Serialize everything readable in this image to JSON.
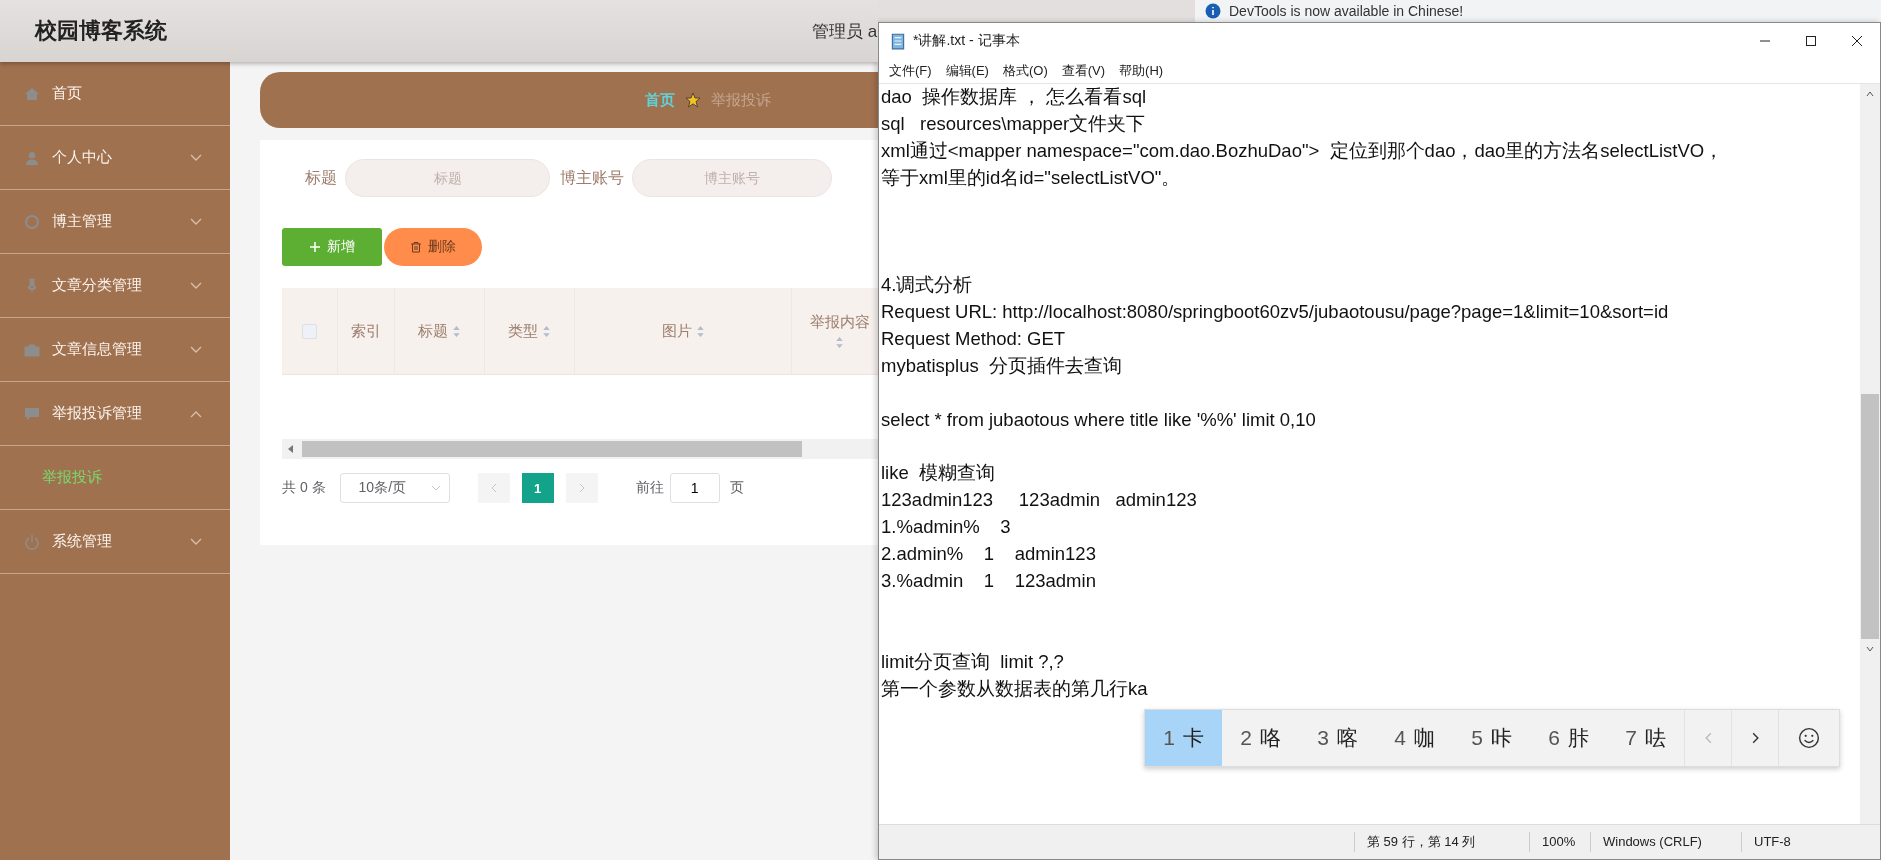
{
  "header": {
    "title": "校园博客系统",
    "user": "管理员 a"
  },
  "sidebar": {
    "items": [
      {
        "label": "首页",
        "kind": "link"
      },
      {
        "label": "个人中心",
        "kind": "menu",
        "expanded": false
      },
      {
        "label": "博主管理",
        "kind": "menu",
        "expanded": false
      },
      {
        "label": "文章分类管理",
        "kind": "menu",
        "expanded": false
      },
      {
        "label": "文章信息管理",
        "kind": "menu",
        "expanded": false
      },
      {
        "label": "举报投诉管理",
        "kind": "menu",
        "expanded": true,
        "children": [
          {
            "label": "举报投诉",
            "selected": true
          }
        ]
      },
      {
        "label": "系统管理",
        "kind": "menu",
        "expanded": false
      }
    ]
  },
  "breadcrumb": [
    "首页",
    "举报投诉"
  ],
  "search": [
    {
      "label": "标题",
      "placeholder": "标题"
    },
    {
      "label": "博主账号",
      "placeholder": "博主账号"
    }
  ],
  "buttons": [
    {
      "label": "新增",
      "kind": "add"
    },
    {
      "label": "删除",
      "kind": "delete"
    }
  ],
  "table": {
    "select_all": {
      "checked": false
    },
    "columns": [
      {
        "label": "索引",
        "sortable": false
      },
      {
        "label": "标题",
        "sortable": true
      },
      {
        "label": "类型",
        "sortable": true
      },
      {
        "label": "图片",
        "sortable": true
      },
      {
        "label": "举报内容",
        "sortable": true
      }
    ]
  },
  "pagination": {
    "total": "共 0 条",
    "page_size": "10条/页",
    "pages": [
      {
        "label": "1",
        "selected": true
      }
    ],
    "goto_label": "前往",
    "goto_value": "1",
    "goto_suffix": "页"
  },
  "devtools_notice": "DevTools is now available in Chinese!",
  "notepad": {
    "title": "*讲解.txt - 记事本",
    "menu": [
      "文件(F)",
      "编辑(E)",
      "格式(O)",
      "查看(V)",
      "帮助(H)"
    ],
    "lines": [
      {
        "kind": "text",
        "text": "dao  操作数据库 ， 怎么看看sql"
      },
      {
        "kind": "text",
        "text": "sql   resources\\mapper文件夹下"
      },
      {
        "kind": "text",
        "text": "xml通过<mapper namespace=\"com.dao.BozhuDao\">  定位到那个dao，dao里的方法名selectListVO，"
      },
      {
        "kind": "text",
        "text": "等于xml里的id名id=\"selectListVO\"。"
      },
      {
        "kind": "blank"
      },
      {
        "kind": "blank"
      },
      {
        "kind": "blank"
      },
      {
        "kind": "text",
        "text": "4.调式分析"
      },
      {
        "kind": "text",
        "text": "Request URL: http://localhost:8080/springboot60zv5/jubaotousu/page?page=1&limit=10&sort=id"
      },
      {
        "kind": "text",
        "text": "Request Method: GET"
      },
      {
        "kind": "text",
        "text": "mybatisplus  分页插件去查询"
      },
      {
        "kind": "blank"
      },
      {
        "kind": "text",
        "text": "select * from jubaotous where title like '%%' limit 0,10"
      },
      {
        "kind": "blank"
      },
      {
        "kind": "text",
        "text": "like  模糊查询"
      },
      {
        "kind": "text",
        "text": "123admin123     123admin   admin123"
      },
      {
        "kind": "text",
        "text": "1.%admin%    3"
      },
      {
        "kind": "text",
        "text": "2.admin%    1    admin123"
      },
      {
        "kind": "text",
        "text": "3.%admin    1    123admin"
      },
      {
        "kind": "blank"
      },
      {
        "kind": "blank"
      },
      {
        "kind": "text",
        "text": "limit分页查询  limit ?,?"
      },
      {
        "kind": "text",
        "text": "第一个参数从数据表的第几行ka"
      }
    ],
    "ime": {
      "candidates": [
        {
          "index": "1",
          "char": "卡",
          "selected": true
        },
        {
          "index": "2",
          "char": "咯",
          "selected": false
        },
        {
          "index": "3",
          "char": "喀",
          "selected": false
        },
        {
          "index": "4",
          "char": "咖",
          "selected": false
        },
        {
          "index": "5",
          "char": "咔",
          "selected": false
        },
        {
          "index": "6",
          "char": "胩",
          "selected": false
        },
        {
          "index": "7",
          "char": "呿",
          "selected": false
        }
      ]
    },
    "status_bar": [
      "第 59 行，第 14 列",
      "100%",
      "Windows (CRLF)",
      "UTF-8"
    ]
  }
}
